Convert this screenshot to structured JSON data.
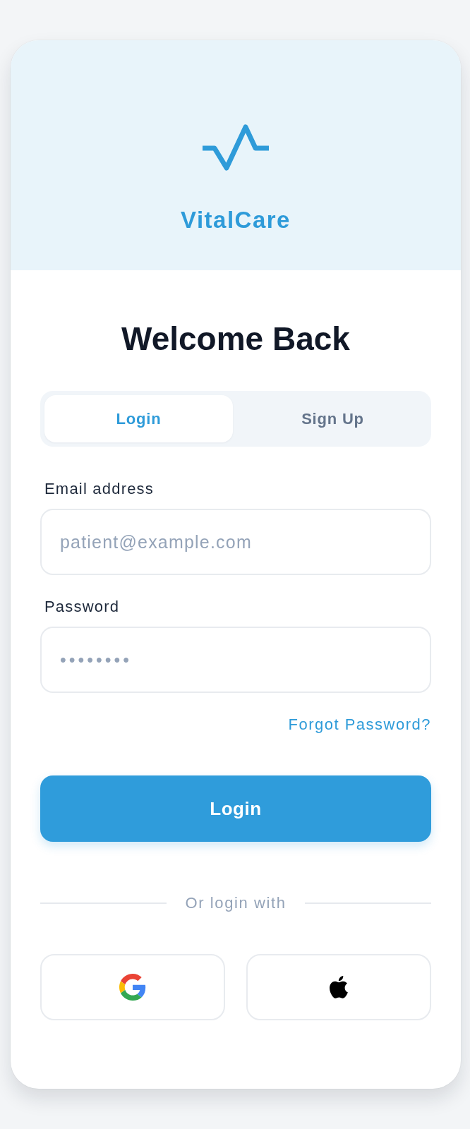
{
  "header": {
    "app_name": "VitalCare"
  },
  "title": "Welcome Back",
  "tabs": [
    {
      "label": "Login",
      "selected": true
    },
    {
      "label": "Sign Up",
      "selected": false
    }
  ],
  "fields": [
    {
      "kind": "email",
      "label": "Email address",
      "placeholder": "patient@example.com"
    },
    {
      "kind": "password",
      "label": "Password",
      "placeholder": "••••••••"
    }
  ],
  "forgot_password_link": "Forgot Password?",
  "submit_button": "Login",
  "divider_text": "Or login with",
  "social_buttons": [
    {
      "kind": "google"
    },
    {
      "kind": "apple"
    }
  ]
}
